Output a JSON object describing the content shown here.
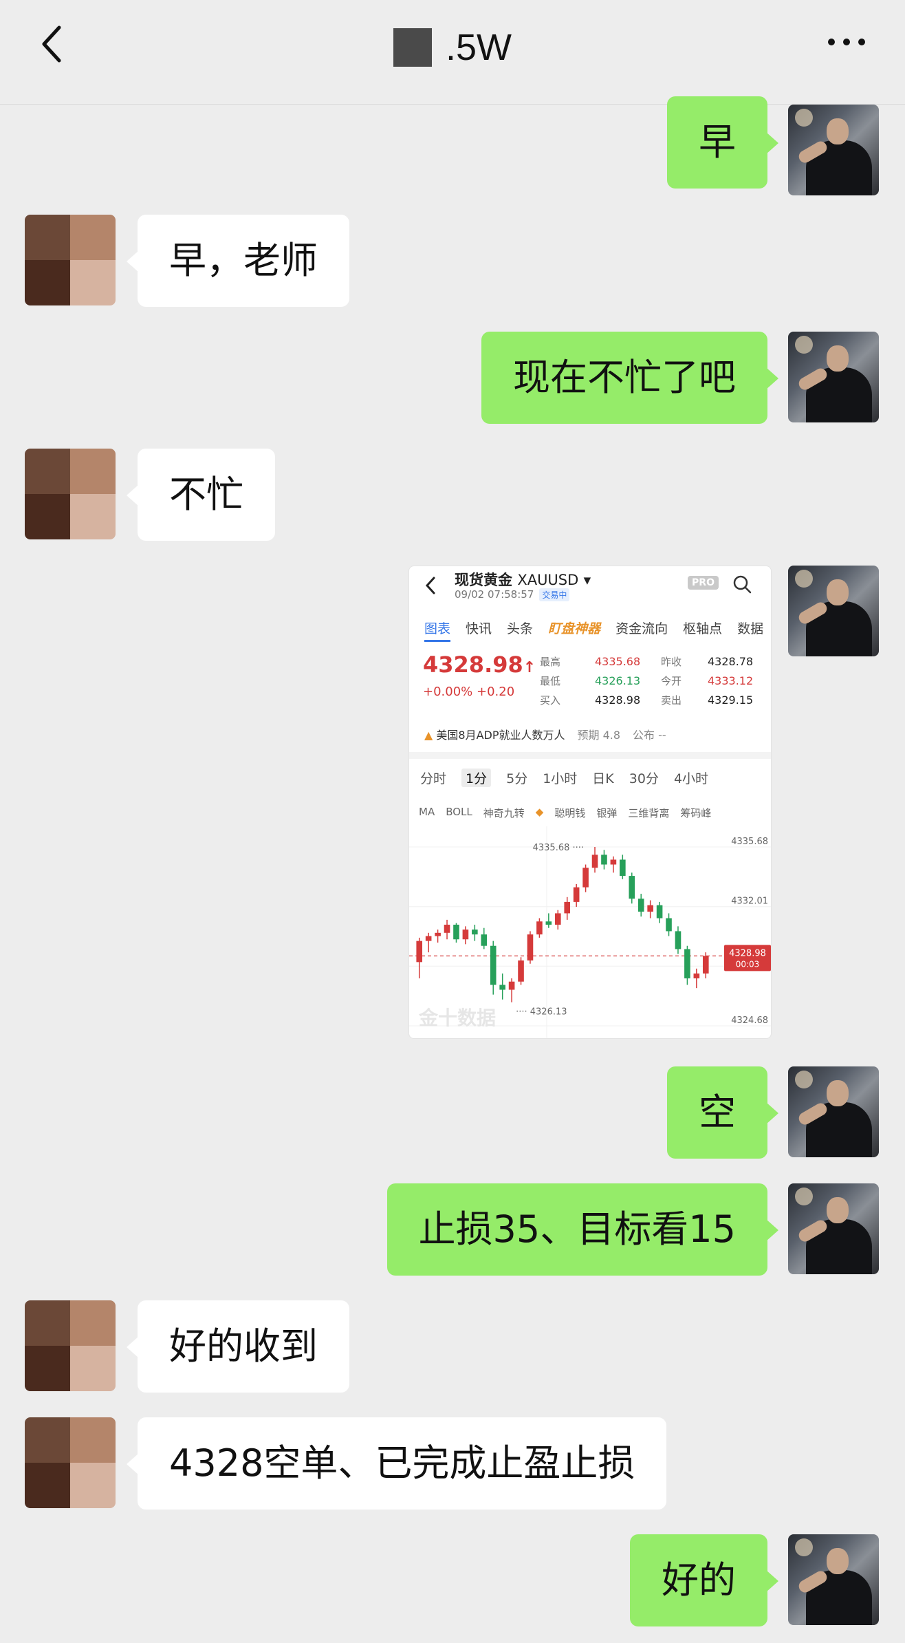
{
  "header": {
    "title": ".5W",
    "back_icon": "chevron-left-icon",
    "more_icon": "more-dots-icon"
  },
  "messages": [
    {
      "side": "me",
      "text": "早"
    },
    {
      "side": "other",
      "text": "早，老师"
    },
    {
      "side": "me",
      "text": "现在不忙了吧"
    },
    {
      "side": "other",
      "text": "不忙"
    },
    {
      "side": "me",
      "type": "image"
    },
    {
      "side": "me",
      "text": "空"
    },
    {
      "side": "me",
      "text": "止损35、目标看15"
    },
    {
      "side": "other",
      "text": "好的收到"
    },
    {
      "side": "other",
      "text": "4328空单、已完成止盈止损"
    },
    {
      "side": "me",
      "text": "好的"
    }
  ],
  "screenshot": {
    "symbol": "现货黄金",
    "code": "XAUUSD",
    "timestamp": "09/02 07:58:57",
    "status": "交易中",
    "pro": "PRO",
    "tabs": [
      "图表",
      "快讯",
      "头条",
      "盯盘神器",
      "资金流向",
      "枢轴点",
      "数据"
    ],
    "price": "4328.98",
    "price_arrow": "↑",
    "change": "+0.00%  +0.20",
    "quote": {
      "high_label": "最高",
      "high": "4335.68",
      "prev_label": "昨收",
      "prev": "4328.78",
      "low_label": "最低",
      "low": "4326.13",
      "open_label": "今开",
      "open": "4333.12",
      "bid_label": "买入",
      "bid": "4328.98",
      "ask_label": "卖出",
      "ask": "4329.15"
    },
    "news": "美国8月ADP就业人数万人",
    "forecast": "预期 4.8",
    "published": "公布 --",
    "timeframes": [
      "分时",
      "1分",
      "5分",
      "1小时",
      "日K",
      "30分",
      "4小时"
    ],
    "indicators": [
      "MA",
      "BOLL",
      "神奇九转",
      "聪明钱",
      "银弹",
      "三维背离",
      "筹码峰"
    ],
    "watermark": "金十数据",
    "chart_data": {
      "type": "candlestick",
      "y_ticks": [
        "4335.68",
        "4332.01",
        "4328.98",
        "4324.68"
      ],
      "max_label": "4335.68",
      "min_label": "4326.13",
      "last_price": "4328.98",
      "countdown": "00:03",
      "ylim": [
        4324.68,
        4335.68
      ],
      "candles": [
        [
          4328.6,
          4330.1,
          4327.6,
          4329.9
        ],
        [
          4329.9,
          4330.4,
          4329.2,
          4330.2
        ],
        [
          4330.2,
          4330.6,
          4329.8,
          4330.4
        ],
        [
          4330.4,
          4331.2,
          4330.0,
          4330.9
        ],
        [
          4330.9,
          4331.0,
          4329.8,
          4330.0
        ],
        [
          4330.0,
          4330.8,
          4329.7,
          4330.6
        ],
        [
          4330.6,
          4330.9,
          4329.9,
          4330.3
        ],
        [
          4330.3,
          4330.7,
          4329.4,
          4329.6
        ],
        [
          4329.6,
          4329.9,
          4326.6,
          4327.2
        ],
        [
          4327.2,
          4327.9,
          4326.3,
          4326.9
        ],
        [
          4326.9,
          4327.6,
          4326.13,
          4327.4
        ],
        [
          4327.4,
          4328.9,
          4327.2,
          4328.7
        ],
        [
          4328.7,
          4330.5,
          4328.5,
          4330.3
        ],
        [
          4330.3,
          4331.3,
          4330.1,
          4331.1
        ],
        [
          4331.1,
          4331.6,
          4330.7,
          4330.9
        ],
        [
          4330.9,
          4331.8,
          4330.6,
          4331.6
        ],
        [
          4331.6,
          4332.6,
          4331.2,
          4332.3
        ],
        [
          4332.3,
          4333.4,
          4332.0,
          4333.2
        ],
        [
          4333.2,
          4334.6,
          4332.9,
          4334.4
        ],
        [
          4334.4,
          4335.68,
          4334.1,
          4335.2
        ],
        [
          4335.2,
          4335.5,
          4334.3,
          4334.6
        ],
        [
          4334.6,
          4335.1,
          4334.1,
          4334.9
        ],
        [
          4334.9,
          4335.2,
          4333.7,
          4333.9
        ],
        [
          4333.9,
          4334.1,
          4332.2,
          4332.5
        ],
        [
          4332.5,
          4332.8,
          4331.4,
          4331.7
        ],
        [
          4331.7,
          4332.4,
          4331.3,
          4332.1
        ],
        [
          4332.1,
          4332.3,
          4331.0,
          4331.3
        ],
        [
          4331.3,
          4331.6,
          4330.2,
          4330.5
        ],
        [
          4330.5,
          4330.8,
          4329.1,
          4329.4
        ],
        [
          4329.4,
          4329.6,
          4327.2,
          4327.6
        ],
        [
          4327.6,
          4328.2,
          4327.0,
          4327.9
        ],
        [
          4327.9,
          4329.2,
          4327.6,
          4328.98
        ]
      ]
    }
  },
  "colors": {
    "me_bubble": "#95ec69",
    "other_bubble": "#ffffff",
    "background": "#ededed",
    "up": "#d53a3a",
    "down": "#27a05a"
  }
}
